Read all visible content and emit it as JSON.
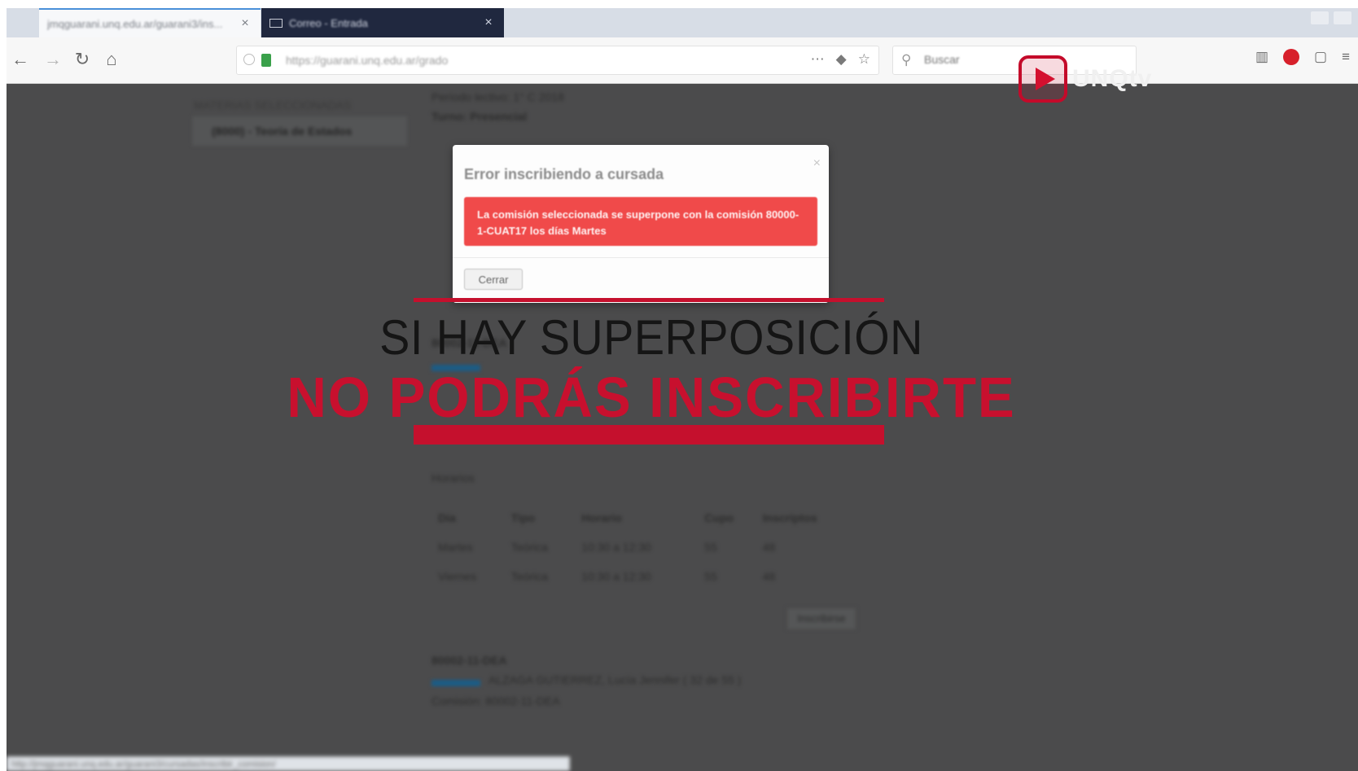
{
  "browser": {
    "tabs": [
      {
        "title": "jmqguarani.unq.edu.ar/guarani3/ins...",
        "active": true
      },
      {
        "title": "Correo - Entrada",
        "active": false
      }
    ],
    "url": "https://guarani.unq.edu.ar/grado",
    "search_placeholder": "Buscar"
  },
  "watermark": {
    "text": "UNQtv"
  },
  "page": {
    "sidebar_title": "MATERIAS SELECCIONADAS",
    "sidebar_item": "(8000) - Teoría de Estados",
    "header_lines": [
      "Período lectivo: 1° C 2018",
      "Turno: Presencial"
    ],
    "subtitle": "Horarios",
    "schedule": {
      "headers": [
        "Día",
        "Tipo",
        "Horario",
        "Cupo",
        "Inscriptos"
      ],
      "rows": [
        [
          "Martes",
          "Teórica",
          "10:30 a 12:30",
          "55",
          "48"
        ],
        [
          "Viernes",
          "Teórica",
          "10:30 a 12:30",
          "55",
          "48"
        ]
      ]
    },
    "inscribir_label": "Inscribirse",
    "commission_code": "80002-11-DEA",
    "commission_detail": "ALZAGA GUTIERREZ, Lucía Jennifer ( 32 de 55 )",
    "commission_line": "Comisión: 80002-11-DEA",
    "status_url": "http://jmqguarani.unq.edu.ar/guarani3/cursadas/inscribir_comision/"
  },
  "modal": {
    "title": "Error inscribiendo a cursada",
    "close": "×",
    "message": "La comisión seleccionada se superpone con la comisión 80000-1-CUAT17 los días Martes",
    "button": "Cerrar"
  },
  "caption": {
    "line1": "SI HAY SUPERPOSICIÓN",
    "line2": "NO PODRÁS INSCRIBIRTE"
  },
  "colors": {
    "accent_red": "#c8102e",
    "alert_red": "#f04a4a",
    "overlay_gray": "#4b4b4c"
  }
}
